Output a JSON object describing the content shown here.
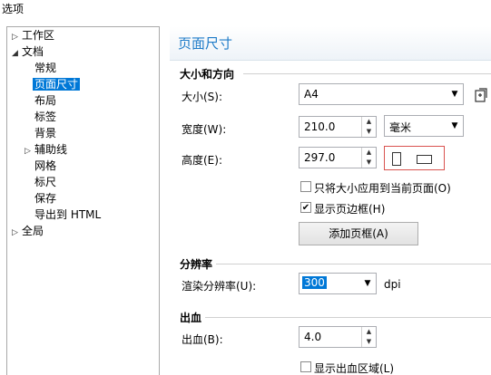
{
  "window": {
    "title": "选项"
  },
  "tree": {
    "items": [
      {
        "label": "工作区",
        "arrow": "▷"
      },
      {
        "label": "文档",
        "arrow": "◢"
      },
      {
        "label": "常规"
      },
      {
        "label": "页面尺寸",
        "selected": true
      },
      {
        "label": "布局"
      },
      {
        "label": "标签"
      },
      {
        "label": "背景"
      },
      {
        "label": "辅助线",
        "arrow": "▷"
      },
      {
        "label": "网格"
      },
      {
        "label": "标尺"
      },
      {
        "label": "保存"
      },
      {
        "label": "导出到 HTML"
      },
      {
        "label": "全局",
        "arrow": "▷"
      }
    ]
  },
  "page": {
    "title": "页面尺寸",
    "size_section": {
      "heading": "大小和方向",
      "size_label": "大小(S):",
      "size_value": "A4",
      "width_label": "宽度(W):",
      "width_value": "210.0",
      "unit_value": "毫米",
      "height_label": "高度(E):",
      "height_value": "297.0",
      "apply_current_only": "只将大小应用到当前页面(O)",
      "apply_current_only_checked": false,
      "show_page_border": "显示页边框(H)",
      "show_page_border_checked": true,
      "add_border_button": "添加页框(A)"
    },
    "resolution_section": {
      "heading": "分辨率",
      "render_label": "渲染分辨率(U):",
      "render_value": "300",
      "unit": "dpi"
    },
    "bleed_section": {
      "heading": "出血",
      "bleed_label": "出血(B):",
      "bleed_value": "4.0",
      "show_bleed_area": "显示出血区域(L)",
      "show_bleed_area_checked": false
    }
  },
  "icons": {
    "save_preset": "save-page-size-icon",
    "portrait": "portrait-orientation-icon",
    "landscape": "landscape-orientation-icon"
  },
  "colors": {
    "title_blue": "#1e7bc8",
    "selection_blue": "#0078d7",
    "orientation_border": "#d9534f"
  }
}
